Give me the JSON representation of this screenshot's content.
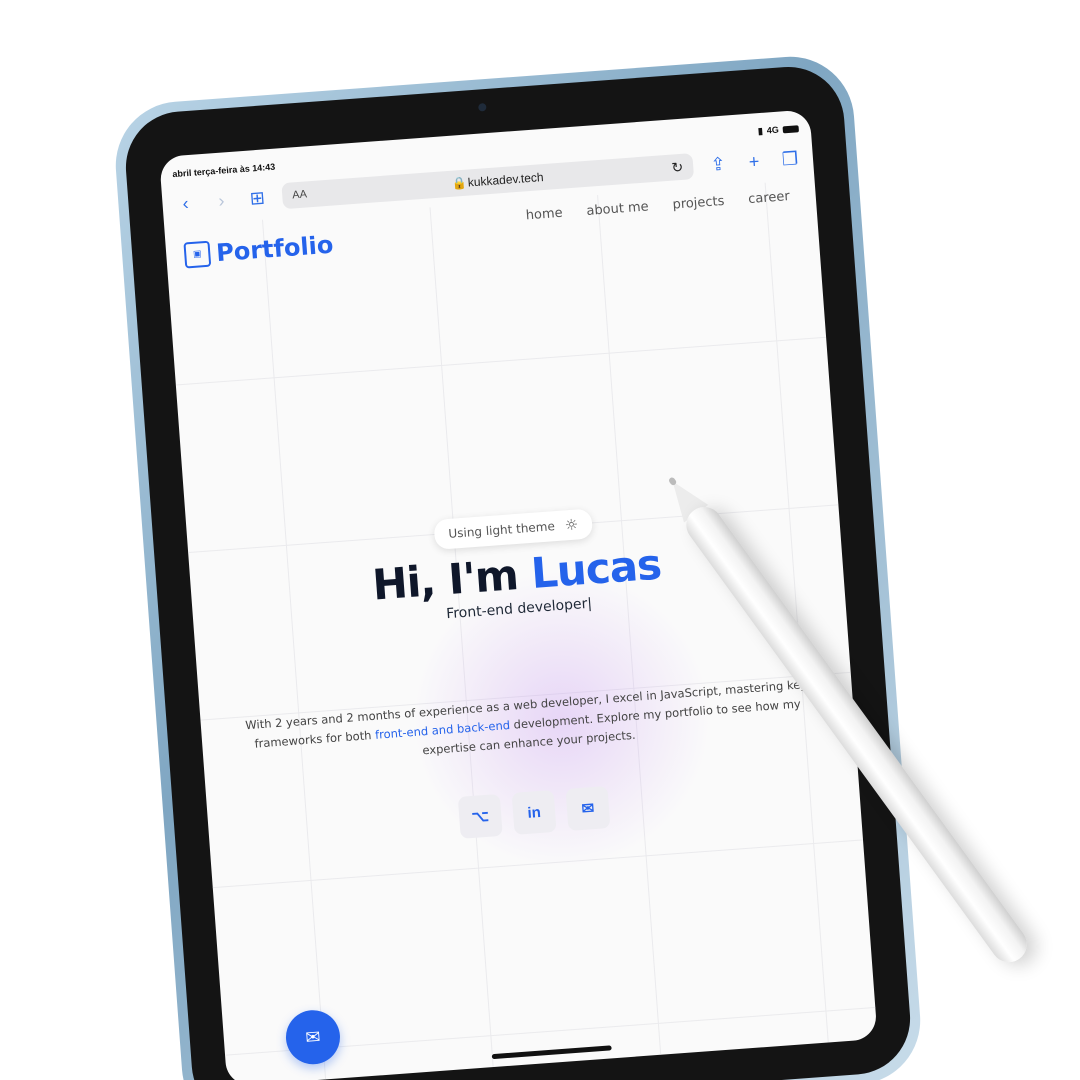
{
  "status_bar": {
    "time": "abril terça-feira às 14:43",
    "network": "4G"
  },
  "browser": {
    "text_size_label": "AA",
    "url": "kukkadev.tech"
  },
  "site": {
    "logo_text": "Portfolio",
    "menu": [
      "home",
      "about me",
      "projects",
      "career"
    ],
    "theme_pill": "Using light theme",
    "hero_greeting": "Hi, I'm ",
    "hero_name": "Lucas",
    "hero_role": "Front-end developer|",
    "description_part1": "With 2 years and 2 months of experience as a web developer, I excel in JavaScript, mastering key frameworks for both ",
    "description_highlight": "front-end and back-end",
    "description_part2": " development. Explore my portfolio to see how my expertise can enhance your projects."
  },
  "icons": {
    "github": "github-icon",
    "linkedin": "linkedin-icon",
    "mail": "mail-icon",
    "sun": "sun-icon"
  },
  "colors": {
    "accent": "#2563eb",
    "text": "#0f172a",
    "background": "#fafafa"
  }
}
